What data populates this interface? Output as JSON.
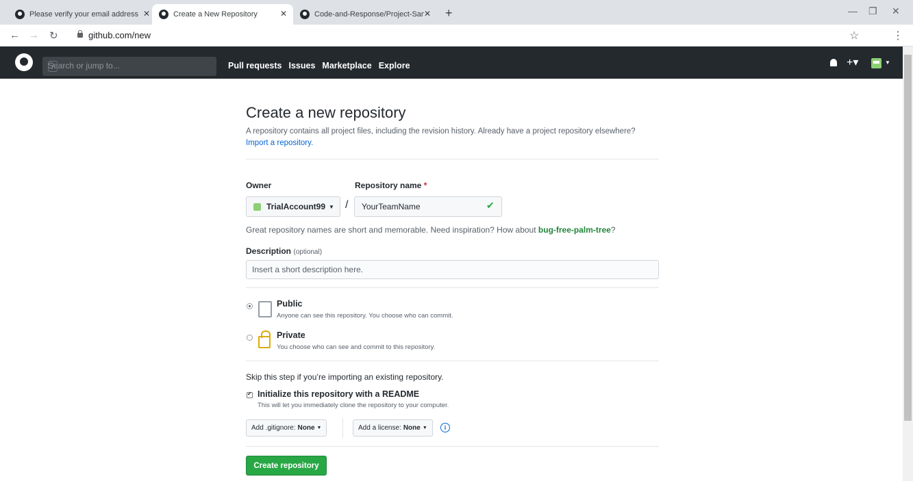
{
  "browser": {
    "tabs": [
      {
        "title": "Please verify your email address"
      },
      {
        "title": "Create a New Repository"
      },
      {
        "title": "Code-and-Response/Project-Sam"
      }
    ],
    "url": "github.com/new"
  },
  "header": {
    "search_placeholder": "Search or jump to...",
    "search_shortcut": "/",
    "nav": [
      "Pull requests",
      "Issues",
      "Marketplace",
      "Explore"
    ]
  },
  "page": {
    "title": "Create a new repository",
    "subtitle": "A repository contains all project files, including the revision history. Already have a project repository elsewhere?",
    "import_link": "Import a repository.",
    "owner_label": "Owner",
    "repo_name_label": "Repository name",
    "required_mark": "*",
    "owner_value": "TrialAccount99",
    "repo_name_value": "YourTeamName",
    "hint_prefix": "Great repository names are short and memorable. Need inspiration? How about",
    "hint_suggestion": "bug-free-palm-tree",
    "hint_suffix": "?",
    "description_label": "Description",
    "description_optional": "(optional)",
    "description_placeholder": "Insert a short description here.",
    "visibility": [
      {
        "title": "Public",
        "desc": "Anyone can see this repository. You choose who can commit.",
        "selected": true
      },
      {
        "title": "Private",
        "desc": "You choose who can see and commit to this repository.",
        "selected": false
      }
    ],
    "skip_text": "Skip this step if you’re importing an existing repository.",
    "readme_label": "Initialize this repository with a README",
    "readme_desc": "This will let you immediately clone the repository to your computer.",
    "readme_checked": true,
    "gitignore_label": "Add .gitignore:",
    "gitignore_value": "None",
    "license_label": "Add a license:",
    "license_value": "None",
    "create_button": "Create repository"
  },
  "colors": {
    "header_bg": "#24292e",
    "create_button": "#28a745",
    "link": "#0366d6"
  }
}
